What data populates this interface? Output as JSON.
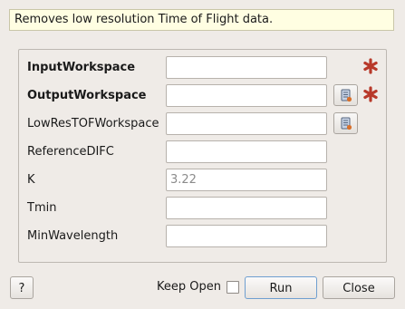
{
  "description": "Removes low resolution Time of Flight data.",
  "fields": [
    {
      "label": "InputWorkspace",
      "value": "",
      "bold": true,
      "browse": false,
      "required": true
    },
    {
      "label": "OutputWorkspace",
      "value": "",
      "bold": true,
      "browse": true,
      "required": true
    },
    {
      "label": "LowResTOFWorkspace",
      "value": "",
      "bold": false,
      "browse": true,
      "required": false
    },
    {
      "label": "ReferenceDIFC",
      "value": "",
      "bold": false,
      "browse": false,
      "required": false
    },
    {
      "label": "K",
      "value": "3.22",
      "bold": false,
      "browse": false,
      "required": false
    },
    {
      "label": "Tmin",
      "value": "",
      "bold": false,
      "browse": false,
      "required": false
    },
    {
      "label": "MinWavelength",
      "value": "",
      "bold": false,
      "browse": false,
      "required": false
    }
  ],
  "icons": {
    "browse": "workspace-browse-icon",
    "required": "required-asterisk-icon"
  },
  "colors": {
    "required": "#b8392a",
    "tooltip_bg": "#fffee2",
    "window_bg": "#efebe7"
  },
  "footer": {
    "help_label": "?",
    "keep_open_label": "Keep Open",
    "keep_open_checked": false,
    "run_label": "Run",
    "close_label": "Close"
  }
}
